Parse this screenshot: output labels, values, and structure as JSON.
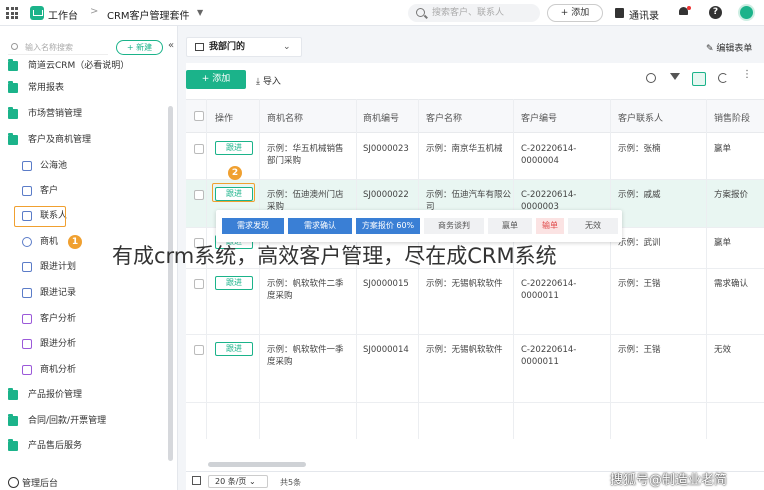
{
  "topbar": {
    "workspace": "工作台",
    "separator": ">",
    "app_name": "CRM客户管理套件",
    "search_placeholder": "搜索客户、联系人",
    "add_label": "+ 添加",
    "contacts_label": "通讯录"
  },
  "sidebar": {
    "search_placeholder": "输入名称搜索",
    "new_label": "+ 新建",
    "collapse": "«",
    "items": [
      {
        "label": "简道云CRM（必看说明）",
        "kind": "folder"
      },
      {
        "label": "常用报表",
        "kind": "folder"
      },
      {
        "label": "市场营销管理",
        "kind": "folder"
      },
      {
        "label": "客户及商机管理",
        "kind": "folder"
      },
      {
        "label": "公海池",
        "kind": "sub"
      },
      {
        "label": "客户",
        "kind": "sub"
      },
      {
        "label": "联系人",
        "kind": "sub"
      },
      {
        "label": "商机",
        "kind": "sub"
      },
      {
        "label": "跟进计划",
        "kind": "sub"
      },
      {
        "label": "跟进记录",
        "kind": "sub"
      },
      {
        "label": "客户分析",
        "kind": "sub"
      },
      {
        "label": "跟进分析",
        "kind": "sub"
      },
      {
        "label": "商机分析",
        "kind": "sub"
      },
      {
        "label": "产品报价管理",
        "kind": "folder"
      },
      {
        "label": "合同/回款/开票管理",
        "kind": "folder"
      },
      {
        "label": "产品售后服务",
        "kind": "folder"
      }
    ],
    "footer": "管理后台",
    "step1": "1"
  },
  "view": {
    "tab": "我部门的",
    "edit_form": "编辑表单"
  },
  "toolbar": {
    "add": "+ 添加",
    "import": "导入"
  },
  "table": {
    "columns": [
      "操作",
      "商机名称",
      "商机编号",
      "客户名称",
      "客户编号",
      "客户联系人",
      "销售阶段"
    ],
    "follow_label": "跟进",
    "step2": "2",
    "rows": [
      {
        "name": "示例：华五机械销售部门采购",
        "code": "SJ0000023",
        "customer": "示例：南京华五机械",
        "cust_code": "C-20220614-0000004",
        "contact": "示例：张楠",
        "stage": "赢单"
      },
      {
        "name": "示例：伍迪澳州门店采购",
        "code": "SJ0000022",
        "customer": "示例：伍迪汽车有限公司",
        "cust_code": "C-20220614-0000003",
        "contact": "示例：戚威",
        "stage": "方案报价"
      },
      {
        "name": "",
        "code": "",
        "customer": "",
        "cust_code": "",
        "contact": "示例：武训",
        "stage": "赢单"
      },
      {
        "name": "示例：帆软软件二季度采购",
        "code": "SJ0000015",
        "customer": "示例：无锡帆软软件",
        "cust_code": "C-20220614-0000011",
        "contact": "示例：王锴",
        "stage": "需求确认"
      },
      {
        "name": "示例：帆软软件一季度采购",
        "code": "SJ0000014",
        "customer": "示例：无锡帆软软件",
        "cust_code": "C-20220614-0000011",
        "contact": "示例：王锴",
        "stage": "无效"
      }
    ]
  },
  "stages": [
    {
      "label": "需求发现",
      "state": "done"
    },
    {
      "label": "需求确认",
      "state": "done"
    },
    {
      "label": "方案报价 60%",
      "state": "done"
    },
    {
      "label": "商务谈判",
      "state": "todo"
    },
    {
      "label": "赢单",
      "state": "todo"
    },
    {
      "label": "输单",
      "state": "lost"
    },
    {
      "label": "无效",
      "state": "inv"
    }
  ],
  "overlay_caption": "有成crm系统，高效客户管理，尽在成CRM系统",
  "pager": {
    "page_size": "20 条/页",
    "total": "共5条"
  },
  "watermark": "搜狐号@制造业老简",
  "colors": {
    "accent": "#1bb38a",
    "stage_done": "#3a7fd5",
    "highlight": "#f0a030"
  }
}
